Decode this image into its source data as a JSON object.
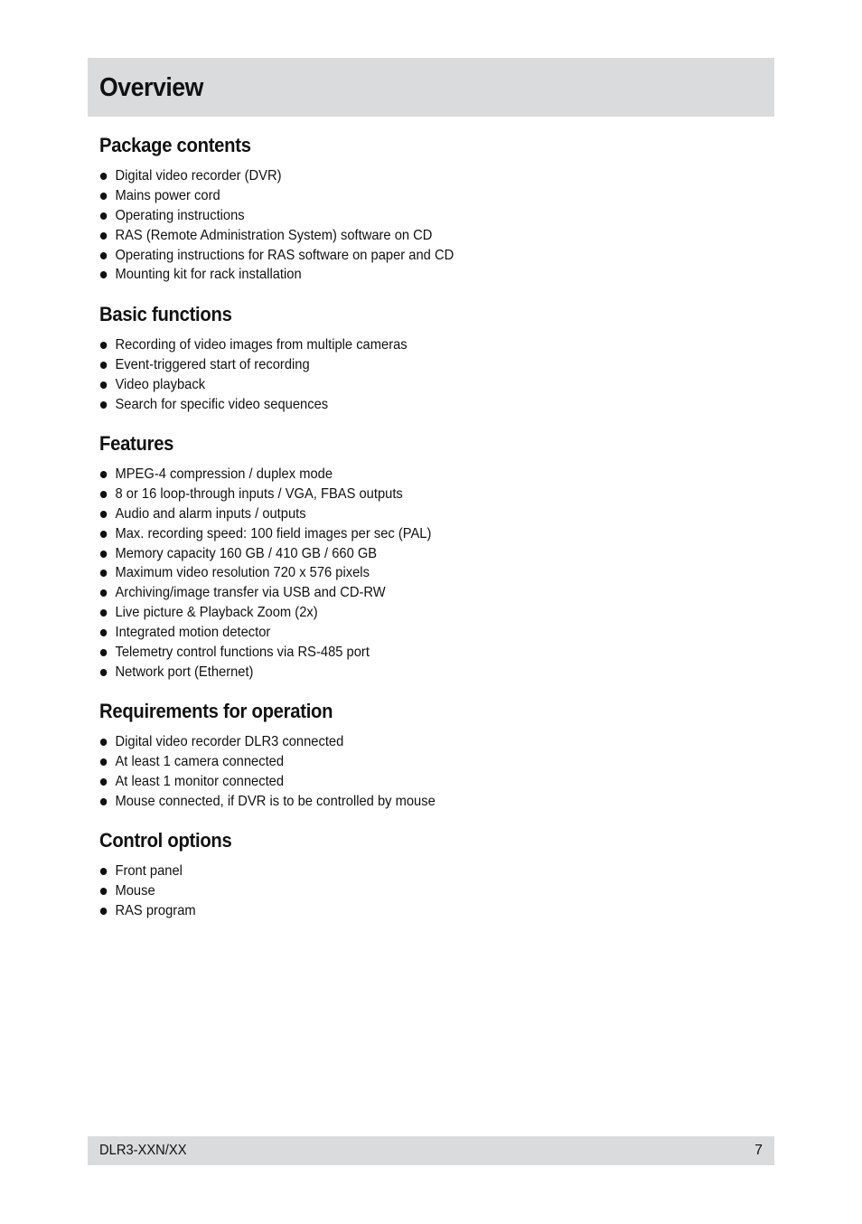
{
  "header": {
    "title": "Overview"
  },
  "sections": [
    {
      "heading": "Package contents",
      "items": [
        "Digital video recorder (DVR)",
        "Mains power cord",
        "Operating instructions",
        "RAS (Remote Administration System) software on CD",
        "Operating instructions for RAS software on paper and CD",
        "Mounting kit for rack installation"
      ]
    },
    {
      "heading": "Basic functions",
      "items": [
        "Recording of video images from multiple cameras",
        "Event-triggered start of recording",
        "Video playback",
        "Search for specific video sequences"
      ]
    },
    {
      "heading": "Features",
      "items": [
        "MPEG-4 compression / duplex mode",
        "8 or 16 loop-through inputs / VGA, FBAS outputs",
        "Audio and alarm inputs / outputs",
        "Max. recording speed: 100 field images per sec (PAL)",
        "Memory capacity 160 GB / 410 GB / 660 GB",
        "Maximum video resolution 720 x 576 pixels",
        "Archiving/image transfer via USB and CD-RW",
        "Live picture & Playback Zoom (2x)",
        "Integrated motion detector",
        "Telemetry control functions via RS-485 port",
        "Network port (Ethernet)"
      ]
    },
    {
      "heading": "Requirements for operation",
      "items": [
        "Digital video recorder DLR3 connected",
        "At least 1 camera connected",
        "At least 1 monitor connected",
        "Mouse connected, if DVR is to be controlled by mouse"
      ]
    },
    {
      "heading": "Control options",
      "items": [
        "Front panel",
        "Mouse",
        "RAS program"
      ]
    }
  ],
  "footer": {
    "model": "DLR3-XXN/XX",
    "page_number": "7"
  }
}
